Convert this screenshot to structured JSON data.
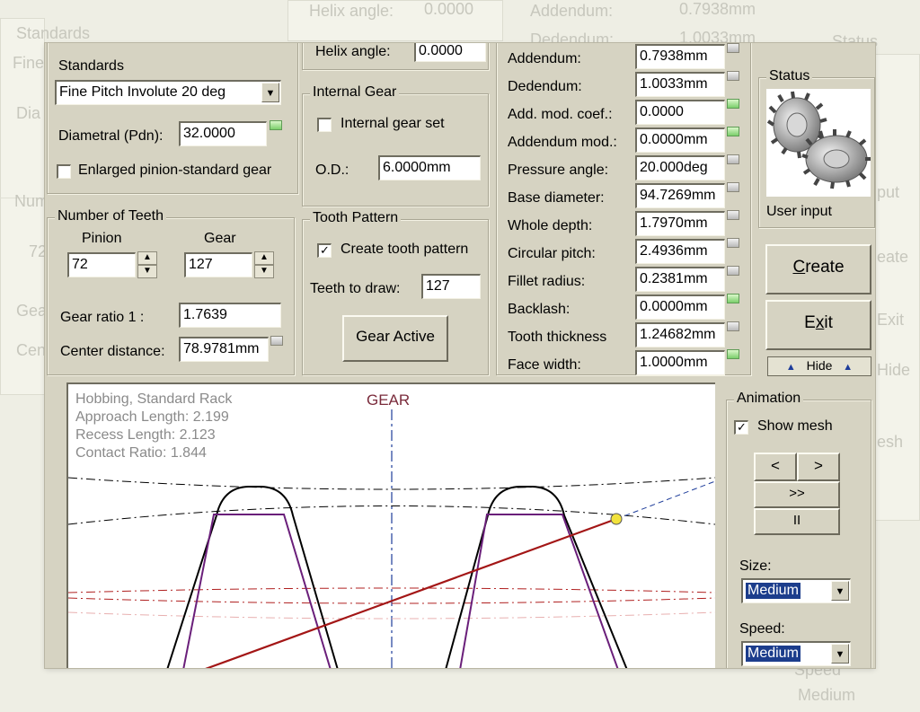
{
  "background": {
    "helix_angle_label": "Helix angle:",
    "helix_angle_value": "0.0000",
    "addendum_label": "Addendum:",
    "addendum_value": "0.7938mm",
    "dedendum_label": "Dedendum:",
    "dedendum_value": "1.0033mm",
    "standards_label": "Standards",
    "fine_text": "Fine",
    "dia_text": "Dia",
    "num_text": "Num",
    "seventy_two": "72",
    "gea_text": "Gea",
    "cen_text": "Cen",
    "status_text": "Status",
    "input_text": "put",
    "create_text": "eate",
    "exit_text": "Exit",
    "hide_text": "Hide",
    "mesh_text": "esh",
    "speed_text": "Speed",
    "medium_text": "Medium"
  },
  "standards": {
    "label": "Standards",
    "selected": "Fine Pitch Involute 20 deg",
    "diametral_label": "Diametral (Pdn):",
    "diametral_value": "32.0000",
    "enlarged_label": "Enlarged pinion-standard gear",
    "enlarged_checked": false
  },
  "helix": {
    "label": "Helix angle:",
    "value": "0.0000"
  },
  "internal_gear": {
    "title": "Internal Gear",
    "checkbox_label": "Internal gear set",
    "checked": false,
    "od_label": "O.D.:",
    "od_value": "6.0000mm"
  },
  "teeth": {
    "title": "Number of Teeth",
    "pinion_label": "Pinion",
    "gear_label": "Gear",
    "pinion_value": "72",
    "gear_value": "127",
    "ratio_label": "Gear ratio 1 :",
    "ratio_value": "1.7639",
    "center_label": "Center distance:",
    "center_value": "78.9781mm"
  },
  "tooth_pattern": {
    "title": "Tooth Pattern",
    "checkbox_label": "Create tooth pattern",
    "checked": true,
    "checkmark": "✓",
    "draw_label": "Teeth to draw:",
    "draw_value": "127",
    "button_label": "Gear Active"
  },
  "params": [
    {
      "label": "Addendum:",
      "value": "0.7938mm",
      "marker": "gray"
    },
    {
      "label": "Dedendum:",
      "value": "1.0033mm",
      "marker": "gray"
    },
    {
      "label": "Add. mod. coef.:",
      "value": "0.0000",
      "marker": "green"
    },
    {
      "label": "Addendum mod.:",
      "value": "0.0000mm",
      "marker": "green"
    },
    {
      "label": "Pressure angle:",
      "value": "20.000deg",
      "marker": "gray"
    },
    {
      "label": "Base diameter:",
      "value": "94.7269mm",
      "marker": "gray"
    },
    {
      "label": "Whole depth:",
      "value": "1.7970mm",
      "marker": "gray"
    },
    {
      "label": "Circular pitch:",
      "value": "2.4936mm",
      "marker": "gray"
    },
    {
      "label": "Fillet radius:",
      "value": "0.2381mm",
      "marker": "gray"
    },
    {
      "label": "Backlash:",
      "value": "0.0000mm",
      "marker": "green"
    },
    {
      "label": "Tooth thickness",
      "value": "1.24682mm",
      "marker": "gray"
    },
    {
      "label": "Face width:",
      "value": "1.0000mm",
      "marker": "green"
    }
  ],
  "status": {
    "title": "Status",
    "caption": "User input"
  },
  "actions": {
    "create_label": "Create",
    "exit_label": "Exit",
    "hide_label": "Hide",
    "hide_arrow": "▲"
  },
  "plot": {
    "info": [
      "Hobbing, Standard Rack",
      "Approach Length: 2.199",
      "Recess Length: 2.123",
      "Contact Ratio: 1.844"
    ],
    "gear_label": "GEAR"
  },
  "animation": {
    "title": "Animation",
    "show_mesh_label": "Show mesh",
    "show_mesh_checked": true,
    "checkmark": "✓",
    "prev_label": "<",
    "next_label": ">",
    "fast_label": ">>",
    "pause_label": "II",
    "size_label": "Size:",
    "size_value": "Medium",
    "speed_label": "Speed:",
    "speed_value": "Medium",
    "dropdown_arrow": "▼",
    "spin_up": "▲",
    "spin_down": "▼"
  },
  "colors": {
    "window_bg": "#d6d3c2",
    "page_bg": "#eeeee4",
    "gear_outline": "#000000",
    "gear_profile": "#6a1f7a",
    "line_of_action": "#a31616",
    "pitch_line": "#b02020",
    "contact_point": "#f2e23c",
    "selection": "#1c3d8c"
  }
}
